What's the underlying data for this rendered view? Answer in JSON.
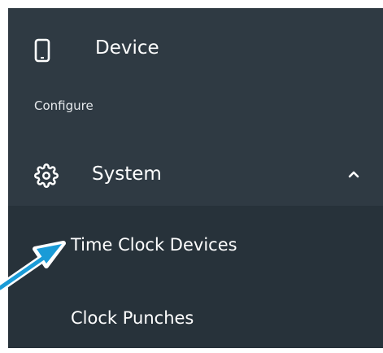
{
  "nav": {
    "device": {
      "label": "Device",
      "icon": "tablet-icon"
    },
    "section_header": "Configure",
    "system": {
      "label": "System",
      "icon": "gear-icon",
      "expanded": true,
      "chevron_icon": "chevron-up-icon",
      "children": [
        {
          "label": "Time Clock Devices"
        },
        {
          "label": "Clock Punches"
        }
      ]
    }
  },
  "annotation": {
    "icon": "pointer-arrow-icon",
    "color": "#1a9bd7"
  },
  "colors": {
    "sidebar_bg": "#2f3a43",
    "submenu_bg": "#27323a",
    "text": "#ffffff"
  }
}
